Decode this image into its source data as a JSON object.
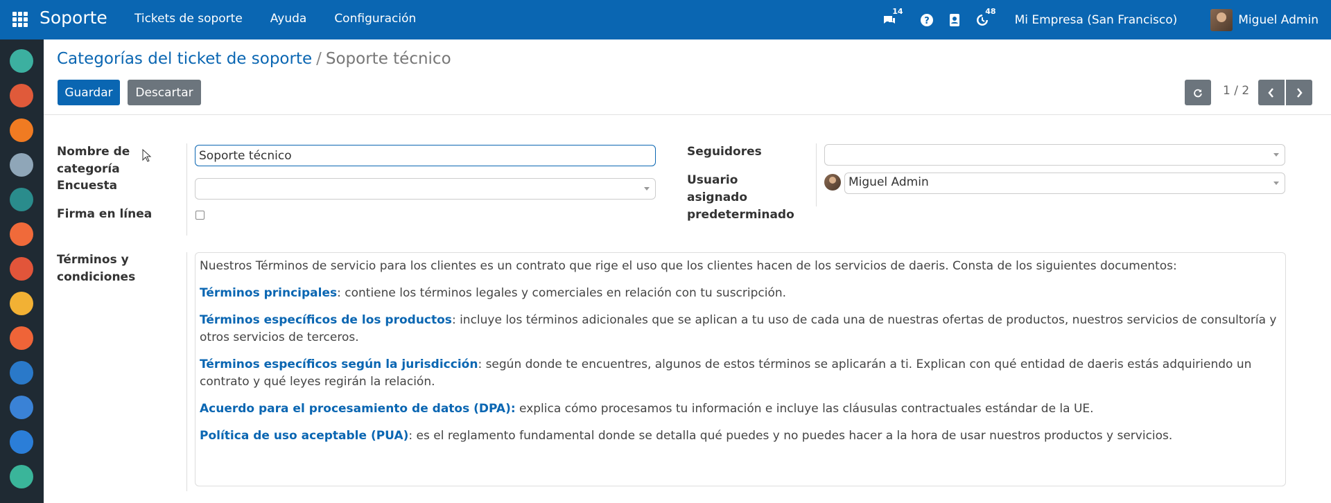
{
  "navbar": {
    "brand": "Soporte",
    "menu": [
      "Tickets de soporte",
      "Ayuda",
      "Configuración"
    ],
    "messages_badge": "14",
    "activities_badge": "48",
    "company": "Mi Empresa (San Francisco)",
    "user": "Miguel Admin"
  },
  "breadcrumb": {
    "parent": "Categorías del ticket de soporte",
    "separator": "/",
    "current": "Soporte técnico"
  },
  "buttons": {
    "save": "Guardar",
    "discard": "Descartar"
  },
  "pager": {
    "value": "1 / 2"
  },
  "form": {
    "category_name_label": "Nombre de categoría",
    "category_name_value": "Soporte técnico",
    "survey_label": "Encuesta",
    "survey_value": "",
    "signature_label": "Firma en línea",
    "signature_checked": false,
    "followers_label": "Seguidores",
    "followers_value": "",
    "default_user_label": "Usuario asignado predeterminado",
    "default_user_value": "Miguel Admin",
    "terms_label": "Términos y condiciones",
    "terms": [
      {
        "bold": "",
        "text": "Nuestros Términos de servicio para los clientes es un contrato que rige el uso que los clientes hacen de los servicios de daeris. Consta de los siguientes documentos:"
      },
      {
        "bold": "Términos principales",
        "text": ": contiene los términos legales y comerciales en relación con tu suscripción."
      },
      {
        "bold": "Términos específicos de los productos",
        "text": ": incluye los términos adicionales que se aplican a tu uso de cada una de nuestras ofertas de productos, nuestros servicios de consultoría y otros servicios de terceros."
      },
      {
        "bold": "Términos específicos según la jurisdicción",
        "text": ": según donde te encuentres, algunos de estos términos se aplicarán a ti. Explican con qué entidad de daeris estás adquiriendo un contrato y qué leyes regirán la relación."
      },
      {
        "bold": "Acuerdo para el procesamiento de datos (DPA):",
        "text": " explica cómo procesamos tu información e incluye las cláusulas contractuales estándar de la UE."
      },
      {
        "bold": "Política de uso aceptable (PUA)",
        "text": ": es el reglamento fundamental donde se detalla qué puedes y no puedes hacer a la hora de usar nuestros productos y servicios."
      }
    ]
  },
  "sidebar_apps": [
    "discuss-app-icon",
    "calendar-app-icon",
    "notes-app-icon",
    "contacts-app-icon",
    "employees-app-icon",
    "crm-app-icon",
    "reporting-app-icon",
    "elearning-app-icon",
    "appraisal-app-icon",
    "mobile-app-icon",
    "calculator-app-icon",
    "events-app-icon",
    "timer-app-icon"
  ],
  "colors": {
    "primary": "#0a66b2",
    "secondary": "#6c757d",
    "sidebar": "#1f2a33"
  }
}
